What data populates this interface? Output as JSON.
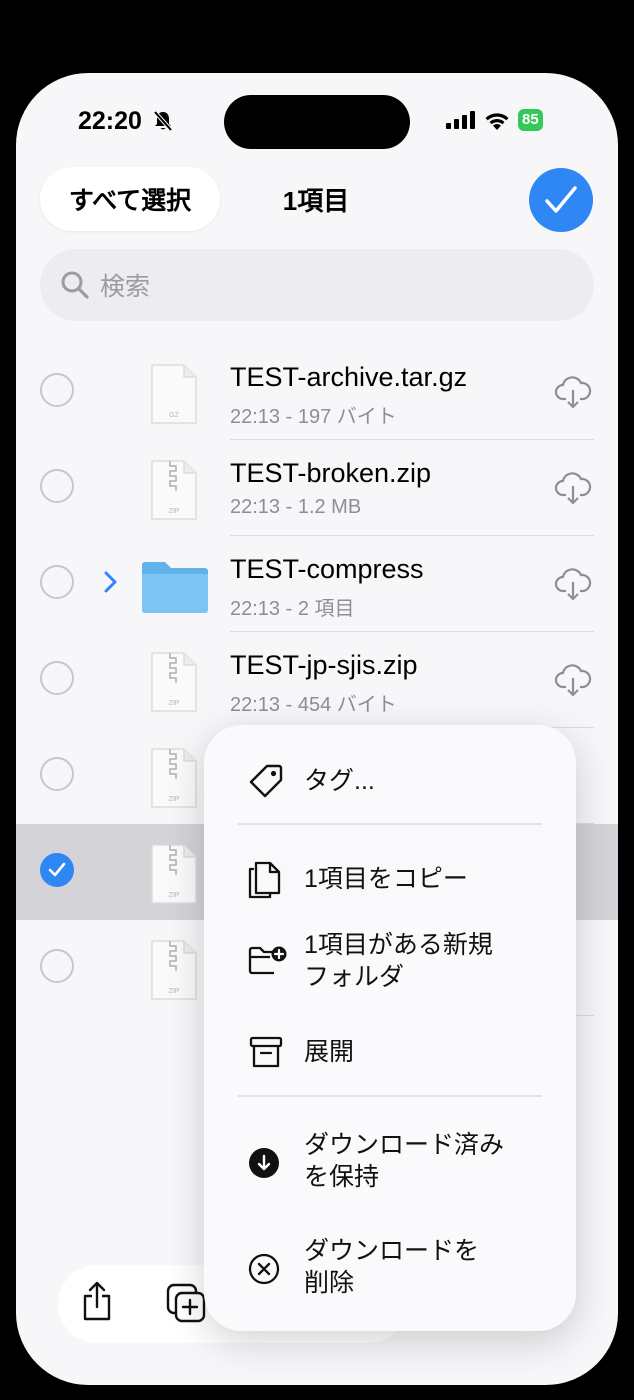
{
  "status_bar": {
    "time": "22:20",
    "battery": "85"
  },
  "nav": {
    "select_all": "すべて選択",
    "title": "1項目"
  },
  "search": {
    "placeholder": "検索"
  },
  "files": [
    {
      "name": "TEST-archive.tar.gz",
      "meta": "22:13 - 197 バイト",
      "type": "gz",
      "doc_label": "GZ",
      "selected": false
    },
    {
      "name": "TEST-broken.zip",
      "meta": "22:13 - 1.2 MB",
      "type": "zip",
      "doc_label": "ZIP",
      "selected": false
    },
    {
      "name": "TEST-compress",
      "meta": "22:13 - 2 項目",
      "type": "folder",
      "selected": false
    },
    {
      "name": "TEST-jp-sjis.zip",
      "meta": "22:13 - 454 バイト",
      "type": "zip",
      "doc_label": "ZIP",
      "selected": false
    },
    {
      "type": "zip",
      "doc_label": "ZIP",
      "selected": false
    },
    {
      "type": "zip",
      "doc_label": "ZIP",
      "selected": true
    },
    {
      "type": "zip",
      "doc_label": "ZIP",
      "selected": false
    }
  ],
  "context_menu": {
    "tags": "タグ...",
    "copy": "1項目をコピー",
    "new_folder_line1": "1項目がある新規",
    "new_folder_line2": "フォルダ",
    "expand": "展開",
    "keep_downloaded_line1": "ダウンロード済み",
    "keep_downloaded_line2": "を保持",
    "remove_download_line1": "ダウンロードを",
    "remove_download_line2": "削除"
  },
  "colors": {
    "accent": "#2f87f5",
    "folder": "#7cc4f2",
    "battery": "#34c759"
  }
}
